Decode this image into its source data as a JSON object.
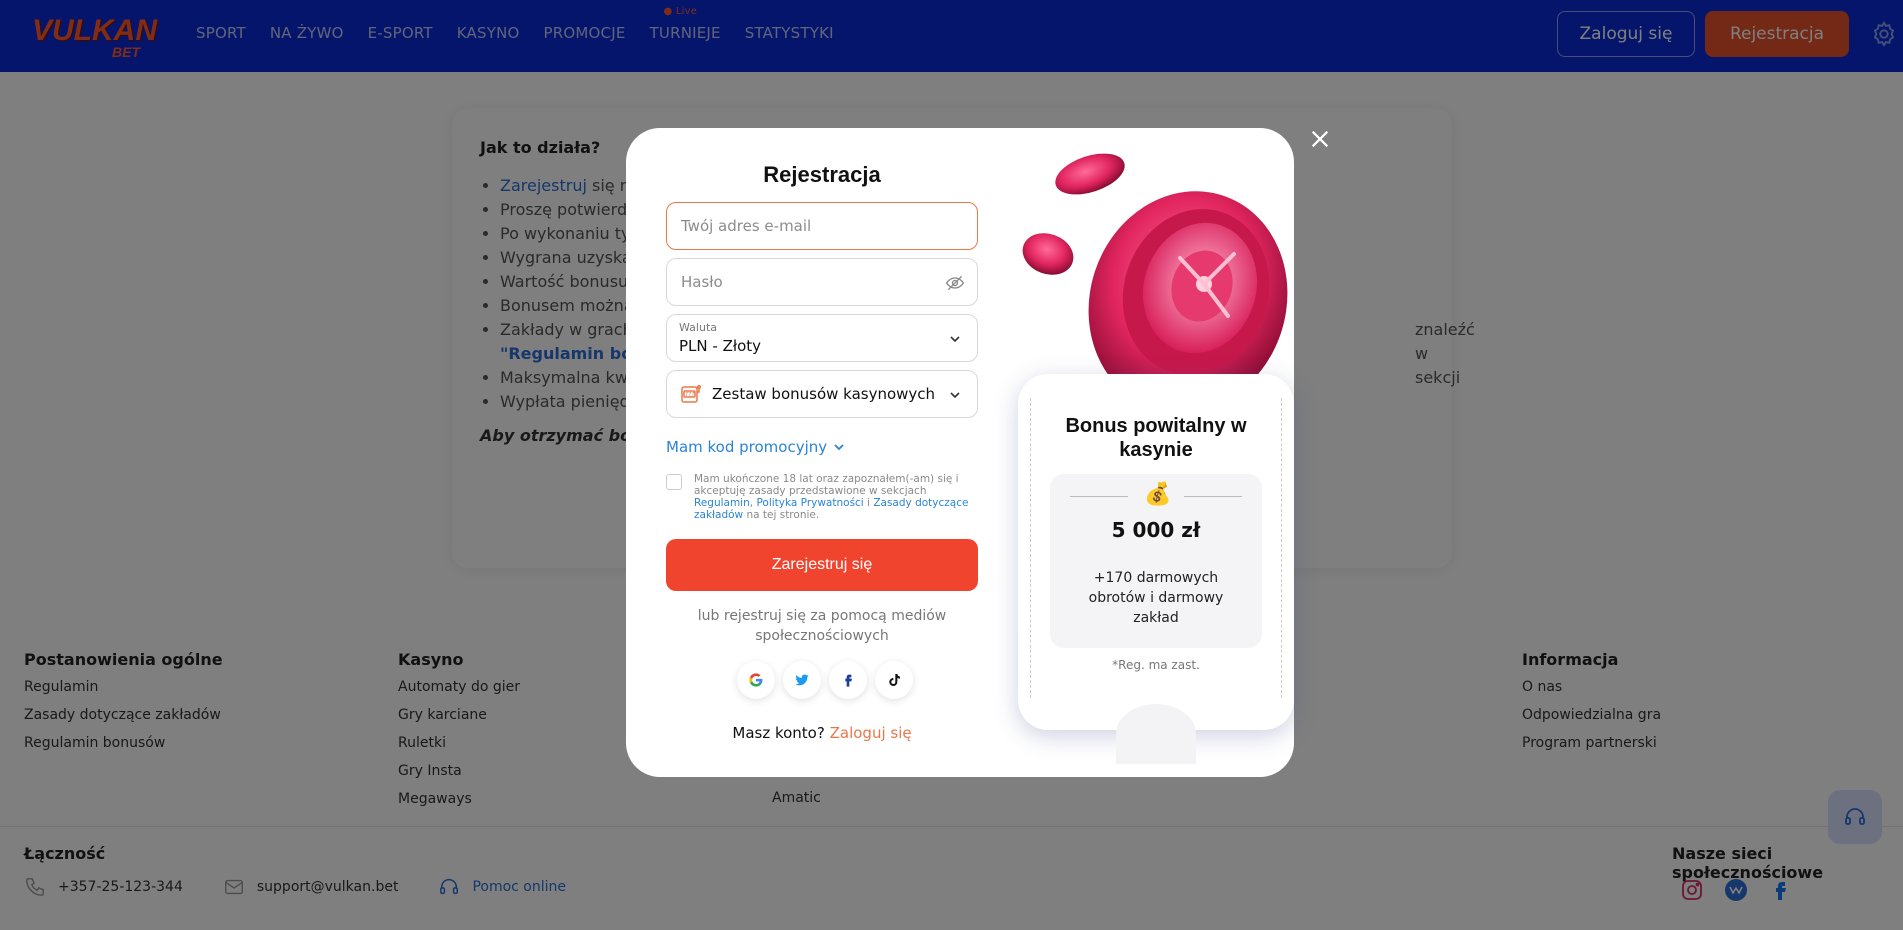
{
  "header": {
    "logo_top": "VULKAN",
    "logo_bottom": "BET",
    "nav": [
      "SPORT",
      "NA ŻYWO",
      "E-SPORT",
      "KASYNO",
      "PROMOCJE",
      "TURNIEJE",
      "STATYSTYKI"
    ],
    "live_badge": "Live",
    "login_label": "Zaloguj się",
    "register_label": "Rejestracja"
  },
  "content": {
    "heading": "Jak to działa?",
    "items": [
      {
        "link": "Zarejestruj",
        "text": " się na"
      },
      {
        "text": "Proszę potwierdz"
      },
      {
        "text": "Po wykonaniu tyc"
      },
      {
        "text": "Wygrana uzyska"
      },
      {
        "text": "Wartość bonusu"
      },
      {
        "text": "Bonusem można"
      },
      {
        "text": "Zakłady w grach",
        "tail": "znaleźć w sekcji"
      },
      {
        "link": "\"Regulamin bonu"
      },
      {
        "text": "Maksymalna kwo"
      },
      {
        "text": "Wypłata pieniędz"
      }
    ],
    "footnote": "Aby otrzymać bon"
  },
  "footer": {
    "columns": [
      {
        "title": "Postanowienia ogólne",
        "links": [
          "Regulamin",
          "Zasady dotyczące zakładów",
          "Regulamin bonusów"
        ]
      },
      {
        "title": "Kasyno",
        "links": [
          "Automaty do gier",
          "Gry karciane",
          "Ruletki",
          "Gry Insta",
          "Megaways"
        ]
      },
      {
        "title": "",
        "links": [
          "Amatic"
        ]
      },
      {
        "title": "Informacja",
        "links": [
          "O nas",
          "Odpowiedzialna gra",
          "Program partnerski"
        ]
      }
    ],
    "contact_title": "Łączność",
    "phone": "+357-25-123-344",
    "email": "support@vulkan.bet",
    "help": "Pomoc online",
    "social_title": "Nasze sieci społecznościowe"
  },
  "modal": {
    "title": "Rejestracja",
    "email_placeholder": "Twój adres e-mail",
    "password_placeholder": "Hasło",
    "currency_label": "Waluta",
    "currency_value": "PLN - Złoty",
    "bonus_select": "Zestaw bonusów kasynowych",
    "promo_toggle": "Mam kod promocyjny",
    "consent_pre": "Mam ukończone 18 lat oraz zapoznałem(-am) się i akceptuję zasady przedstawione w sekcjach ",
    "consent_link1": "Regulamin",
    "consent_sep1": ", ",
    "consent_link2": "Polityka Prywatności",
    "consent_sep2": " i ",
    "consent_link3": "Zasady dotyczące zakładów",
    "consent_post": " na tej stronie.",
    "submit_label": "Zarejestruj się",
    "social_text": "lub rejestruj się za pomocą mediów społecznościowych",
    "have_account": "Masz konto?",
    "login_link": "Zaloguj się",
    "bonus": {
      "title": "Bonus powitalny w kasynie",
      "amount": "5 000 zł",
      "description": "+170 darmowych obrotów i darmowy zakład",
      "note": "*Reg. ma zast."
    }
  },
  "colors": {
    "header_bg": "#0b2ad8",
    "accent_orange": "#f0442e",
    "link_blue": "#2a84d6"
  }
}
